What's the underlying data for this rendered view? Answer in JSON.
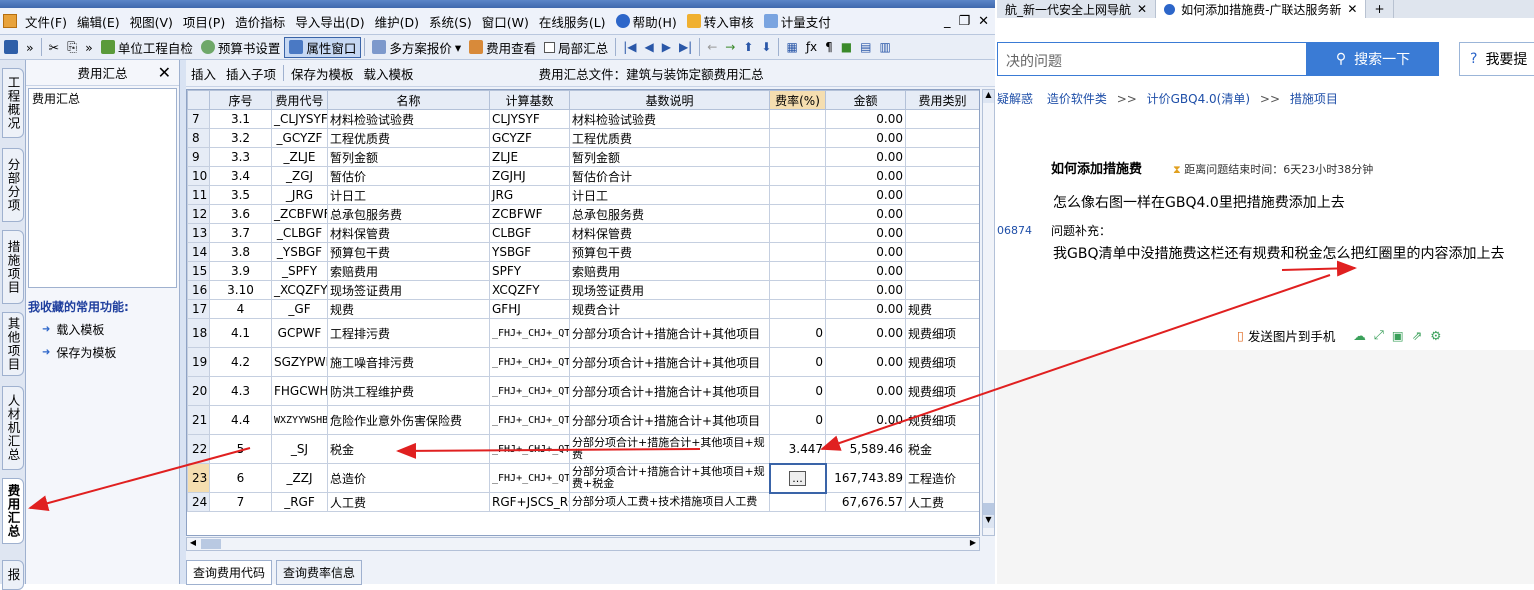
{
  "menu": {
    "items": [
      "文件(F)",
      "编辑(E)",
      "视图(V)",
      "项目(P)",
      "造价指标",
      "导入导出(D)",
      "维护(D)",
      "系统(S)",
      "窗口(W)",
      "在线服务(L)",
      "帮助(H)",
      "转入审核",
      "计量支付"
    ]
  },
  "toolbar": {
    "unit_check": "单位工程自检",
    "budget_settings": "预算书设置",
    "attr_window": "属性窗口",
    "multi_plan": "多方案报价",
    "fee_view": "费用查看",
    "local_summary": "局部汇总"
  },
  "vtabs": [
    "工程概况",
    "分部分项",
    "措施项目",
    "其他项目",
    "人材机汇总",
    "费用汇总",
    "报"
  ],
  "left_panel": {
    "title": "费用汇总",
    "tree_item": "费用汇总",
    "fav_title": "我收藏的常用功能:",
    "fav_items": [
      "载入模板",
      "保存为模板"
    ]
  },
  "content_toolbar": {
    "insert": "插入",
    "insert_child": "插入子项",
    "save_template": "保存为模板",
    "load_template": "载入模板",
    "file_title": "费用汇总文件：建筑与装饰定额费用汇总"
  },
  "table": {
    "headers": [
      "",
      "序号",
      "费用代号",
      "名称",
      "计算基数",
      "基数说明",
      "费率(%)",
      "金额",
      "费用类别"
    ],
    "rows": [
      {
        "rn": "7",
        "seq": "3.1",
        "code": "_CLJYSYF",
        "name": "材料检验试验费",
        "base": "CLJYSYF",
        "desc": "材料检验试验费",
        "rate": "",
        "amount": "0.00",
        "cat": ""
      },
      {
        "rn": "8",
        "seq": "3.2",
        "code": "_GCYZF",
        "name": "工程优质费",
        "base": "GCYZF",
        "desc": "工程优质费",
        "rate": "",
        "amount": "0.00",
        "cat": ""
      },
      {
        "rn": "9",
        "seq": "3.3",
        "code": "_ZLJE",
        "name": "暂列金额",
        "base": "ZLJE",
        "desc": "暂列金额",
        "rate": "",
        "amount": "0.00",
        "cat": ""
      },
      {
        "rn": "10",
        "seq": "3.4",
        "code": "_ZGJ",
        "name": "暂估价",
        "base": "ZGJHJ",
        "desc": "暂估价合计",
        "rate": "",
        "amount": "0.00",
        "cat": ""
      },
      {
        "rn": "11",
        "seq": "3.5",
        "code": "_JRG",
        "name": "计日工",
        "base": "JRG",
        "desc": "计日工",
        "rate": "",
        "amount": "0.00",
        "cat": ""
      },
      {
        "rn": "12",
        "seq": "3.6",
        "code": "_ZCBFWF",
        "name": "总承包服务费",
        "base": "ZCBFWF",
        "desc": "总承包服务费",
        "rate": "",
        "amount": "0.00",
        "cat": ""
      },
      {
        "rn": "13",
        "seq": "3.7",
        "code": "_CLBGF",
        "name": "材料保管费",
        "base": "CLBGF",
        "desc": "材料保管费",
        "rate": "",
        "amount": "0.00",
        "cat": ""
      },
      {
        "rn": "14",
        "seq": "3.8",
        "code": "_YSBGF",
        "name": "预算包干费",
        "base": "YSBGF",
        "desc": "预算包干费",
        "rate": "",
        "amount": "0.00",
        "cat": ""
      },
      {
        "rn": "15",
        "seq": "3.9",
        "code": "_SPFY",
        "name": "索赔费用",
        "base": "SPFY",
        "desc": "索赔费用",
        "rate": "",
        "amount": "0.00",
        "cat": ""
      },
      {
        "rn": "16",
        "seq": "3.10",
        "code": "_XCQZFY",
        "name": "现场签证费用",
        "base": "XCQZFY",
        "desc": "现场签证费用",
        "rate": "",
        "amount": "0.00",
        "cat": ""
      },
      {
        "rn": "17",
        "seq": "4",
        "code": "_GF",
        "name": "规费",
        "base": "GFHJ",
        "desc": "规费合计",
        "rate": "",
        "amount": "0.00",
        "cat": "规费"
      },
      {
        "rn": "18",
        "seq": "4.1",
        "code": "GCPWF",
        "name": "工程排污费",
        "base": "_FHJ+_CHJ+_QTXM",
        "desc": "分部分项合计+措施合计+其他项目",
        "rate": "0",
        "amount": "0.00",
        "cat": "规费细项"
      },
      {
        "rn": "19",
        "seq": "4.2",
        "code": "SGZYPWF",
        "name": "施工噪音排污费",
        "base": "_FHJ+_CHJ+_QTXM",
        "desc": "分部分项合计+措施合计+其他项目",
        "rate": "0",
        "amount": "0.00",
        "cat": "规费细项"
      },
      {
        "rn": "20",
        "seq": "4.3",
        "code": "FHGCWHF",
        "name": "防洪工程维护费",
        "base": "_FHJ+_CHJ+_QTXM",
        "desc": "分部分项合计+措施合计+其他项目",
        "rate": "0",
        "amount": "0.00",
        "cat": "规费细项"
      },
      {
        "rn": "21",
        "seq": "4.4",
        "code": "WXZYYWSHBXF",
        "name": "危险作业意外伤害保险费",
        "base": "_FHJ+_CHJ+_QTXM",
        "desc": "分部分项合计+措施合计+其他项目",
        "rate": "0",
        "amount": "0.00",
        "cat": "规费细项"
      },
      {
        "rn": "22",
        "seq": "5",
        "code": "_SJ",
        "name": "税金",
        "base": "_FHJ+_CHJ+_QTXM+_GF",
        "desc": "分部分项合计+措施合计+其他项目+规费",
        "rate": "3.447",
        "amount": "5,589.46",
        "cat": "税金"
      },
      {
        "rn": "23",
        "seq": "6",
        "code": "_ZZJ",
        "name": "总造价",
        "base": "_FHJ+_CHJ+_QTXM+_GF+_SJ",
        "desc": "分部分项合计+措施合计+其他项目+规费+税金",
        "rate": "...",
        "amount": "167,743.89",
        "cat": "工程造价"
      },
      {
        "rn": "24",
        "seq": "7",
        "code": "_RGF",
        "name": "人工费",
        "base": "RGF+JSCS_RGF",
        "desc": "分部分项人工费+技术措施项目人工费",
        "rate": "",
        "amount": "67,676.57",
        "cat": "人工费"
      }
    ]
  },
  "bottom_tabs": [
    "查询费用代码",
    "查询费率信息"
  ],
  "browser": {
    "tabs": [
      "航_新一代安全上网导航",
      "如何添加措施费-广联达服务新"
    ],
    "search_placeholder": "决的问题",
    "search_btn": "搜索一下",
    "ask_btn": "我要提",
    "crumbs": [
      "疑解惑",
      "造价软件类",
      ">>",
      "计价GBQ4.0(清单)",
      ">>",
      "措施项目"
    ],
    "question_title": "如何添加措施费",
    "question_time": "距离问题结束时间：6天23小时38分钟",
    "question_body": "怎么像右图一样在GBQ4.0里把措施费添加上去",
    "user_id": "06874",
    "supplement_label": "问题补充：",
    "supplement_body": "我GBQ清单中没措施费这栏还有规费和税金怎么把红圈里的内容添加上去",
    "send_to_phone": "发送图片到手机"
  }
}
